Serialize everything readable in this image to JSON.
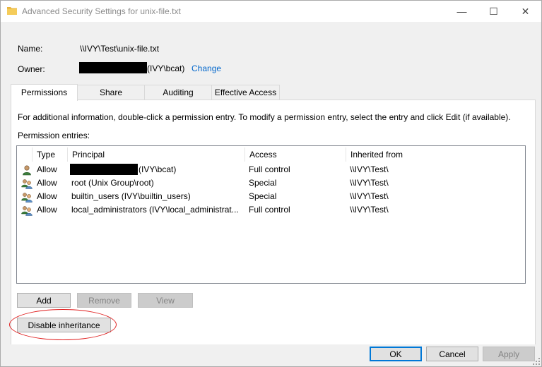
{
  "window": {
    "title": "Advanced Security Settings for unix-file.txt",
    "minimize_glyph": "—",
    "maximize_glyph": "☐",
    "close_glyph": "✕"
  },
  "info": {
    "name_label": "Name:",
    "name_value": "\\\\IVY\\Test\\unix-file.txt",
    "owner_label": "Owner:",
    "owner_suffix": "(IVY\\bcat)",
    "change_link": "Change"
  },
  "tabs": [
    {
      "label": "Permissions"
    },
    {
      "label": "Share"
    },
    {
      "label": "Auditing"
    },
    {
      "label": "Effective Access"
    }
  ],
  "permissions": {
    "info_text": "For additional information, double-click a permission entry. To modify a permission entry, select the entry and click Edit (if available).",
    "entries_label": "Permission entries:",
    "columns": [
      "Type",
      "Principal",
      "Access",
      "Inherited from"
    ],
    "rows": [
      {
        "type": "Allow",
        "principal": "(IVY\\bcat)",
        "access": "Full control",
        "inherited": "\\\\IVY\\Test\\",
        "icon": "single-user-icon",
        "redacted": true
      },
      {
        "type": "Allow",
        "principal": "root (Unix Group\\root)",
        "access": "Special",
        "inherited": "\\\\IVY\\Test\\",
        "icon": "group-icon",
        "redacted": false
      },
      {
        "type": "Allow",
        "principal": "builtin_users (IVY\\builtin_users)",
        "access": "Special",
        "inherited": "\\\\IVY\\Test\\",
        "icon": "group-icon",
        "redacted": false
      },
      {
        "type": "Allow",
        "principal": "local_administrators (IVY\\local_administrat...",
        "access": "Full control",
        "inherited": "\\\\IVY\\Test\\",
        "icon": "group-icon",
        "redacted": false
      }
    ],
    "add_label": "Add",
    "remove_label": "Remove",
    "view_label": "View",
    "disable_inheritance_label": "Disable inheritance"
  },
  "footer": {
    "ok_label": "OK",
    "cancel_label": "Cancel",
    "apply_label": "Apply"
  },
  "colors": {
    "link": "#0066cc",
    "highlight_ellipse": "#e02020",
    "default_button_border": "#0078d7"
  }
}
